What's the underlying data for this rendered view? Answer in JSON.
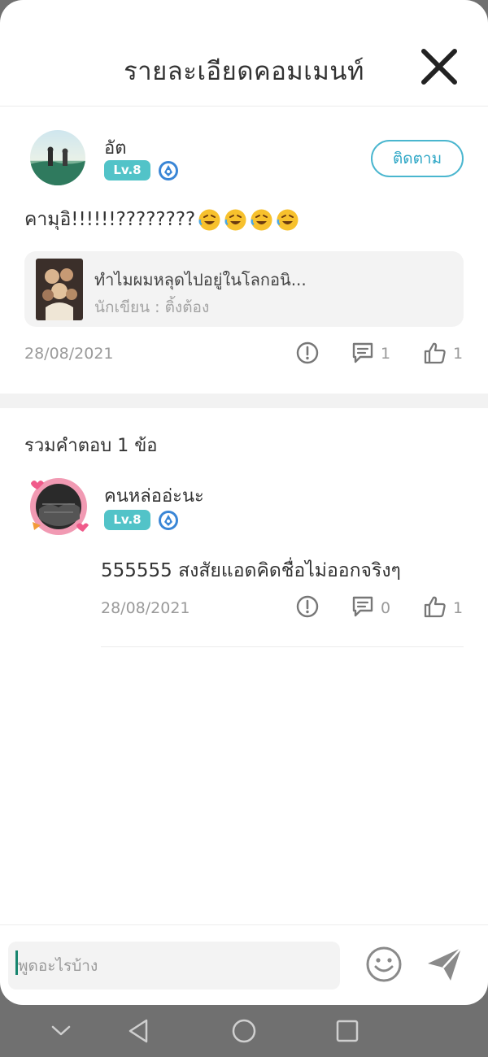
{
  "header": {
    "title": "รายละเอียดคอมเมนท์"
  },
  "comment": {
    "username": "อัต",
    "level": "Lv.8",
    "follow_label": "ติดตาม",
    "text": "คามุอิ!!!!!!????????",
    "emojis": [
      "rolling-on-floor-laughing",
      "rolling-on-floor-laughing",
      "rolling-on-floor-laughing",
      "rolling-on-floor-laughing"
    ],
    "book": {
      "title": "ทำไมผมหลุดไปอยู่ในโลกอนิ...",
      "author": "นักเขียน : ติ้งต้อง"
    },
    "date": "28/08/2021",
    "reply_count": "1",
    "like_count": "1"
  },
  "replies": {
    "title": "รวมคำตอบ 1 ข้อ",
    "items": [
      {
        "username": "คนหล่ออ่ะนะ",
        "level": "Lv.8",
        "text": "555555 สงสัยแอดคิดชื่อไม่ออกจริงๆ",
        "date": "28/08/2021",
        "reply_count": "0",
        "like_count": "1"
      }
    ]
  },
  "input": {
    "placeholder": "พูดอะไรบ้าง"
  },
  "colors": {
    "accent": "#4ab6cf",
    "badge": "#52c3c8",
    "muted": "#9a9a9a",
    "navbar": "#707070"
  }
}
